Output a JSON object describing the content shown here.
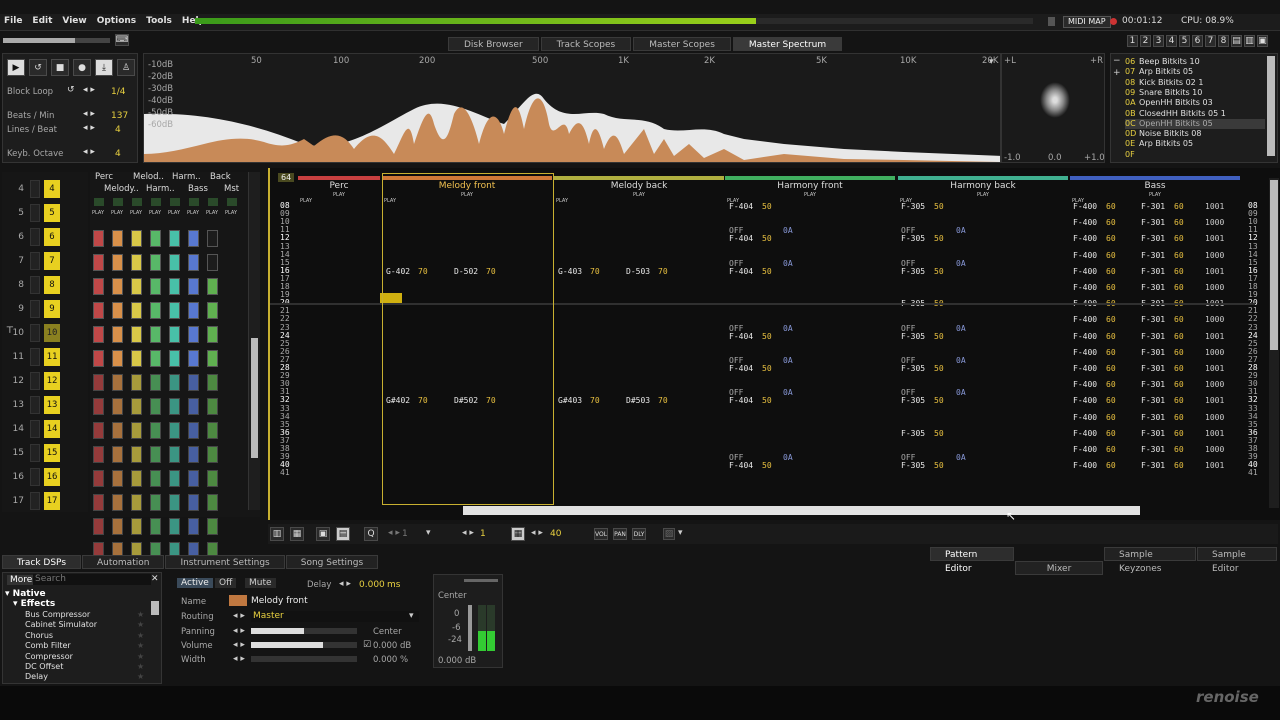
{
  "menu": [
    "File",
    "Edit",
    "View",
    "Options",
    "Tools",
    "Help"
  ],
  "status": {
    "midi_map": "MIDI MAP",
    "time": "00:01:12",
    "cpu": "CPU: 08.9%"
  },
  "screens": [
    "1",
    "2",
    "3",
    "4",
    "5",
    "6",
    "7",
    "8"
  ],
  "scope_tabs": [
    "Disk Browser",
    "Track Scopes",
    "Master Scopes",
    "Master Spectrum"
  ],
  "transport": {
    "block_loop": "Block Loop",
    "block_loop_val": "1/4",
    "bpm_label": "Beats / Min",
    "bpm": "137",
    "lpb_label": "Lines / Beat",
    "lpb": "4",
    "octave_label": "Keyb. Octave",
    "octave": "4"
  },
  "spectrum": {
    "db": [
      "-10dB",
      "-20dB",
      "-30dB",
      "-40dB",
      "-50dB",
      "-60dB"
    ],
    "hz": [
      "50",
      "100",
      "200",
      "500",
      "1K",
      "2K",
      "5K",
      "10K",
      "20K"
    ],
    "l": "+L",
    "r": "+R",
    "axis": [
      "-1.0",
      "0.0",
      "+1.0"
    ]
  },
  "instruments": [
    {
      "id": "06",
      "name": "Beep Bitkits 10"
    },
    {
      "id": "07",
      "name": "Arp Bitkits 05"
    },
    {
      "id": "08",
      "name": "Kick Bitkits 02 1"
    },
    {
      "id": "09",
      "name": "Snare Bitkits 10"
    },
    {
      "id": "0A",
      "name": "OpenHH Bitkits 03"
    },
    {
      "id": "0B",
      "name": "ClosedHH Bitkits 05 1"
    },
    {
      "id": "0C",
      "name": "OpenHH Bitkits 05"
    },
    {
      "id": "0D",
      "name": "Noise Bitkits 08"
    },
    {
      "id": "0E",
      "name": "Arp Bitkits 05"
    },
    {
      "id": "0F",
      "name": ""
    }
  ],
  "sequence": [
    "4",
    "5",
    "6",
    "7",
    "8",
    "9",
    "10",
    "11",
    "12",
    "13",
    "14",
    "15",
    "16",
    "17"
  ],
  "seq_rows": [
    "4",
    "5",
    "6",
    "7",
    "8",
    "9",
    "10",
    "11",
    "12",
    "13",
    "14",
    "15",
    "16",
    "17"
  ],
  "matrix_headers": [
    "Perc",
    "Melod..",
    "Harm..",
    "Back",
    "Melody..",
    "Harm..",
    "Bass",
    "Mst"
  ],
  "play": "PLAY",
  "pattern": {
    "lines": "64",
    "rows": [
      "08",
      "09",
      "10",
      "11",
      "12",
      "13",
      "14",
      "15",
      "16",
      "17",
      "18",
      "19",
      "20",
      "21",
      "22",
      "23",
      "24",
      "25",
      "26",
      "27",
      "28",
      "29",
      "30",
      "31",
      "32",
      "33",
      "34",
      "35",
      "36",
      "37",
      "38",
      "39",
      "40",
      "41"
    ]
  },
  "tracks": [
    {
      "name": "Perc",
      "color": "#c84040"
    },
    {
      "name": "Melody front",
      "color": "#d07838"
    },
    {
      "name": "Melody back",
      "color": "#b0b040"
    },
    {
      "name": "Harmony front",
      "color": "#40b060"
    },
    {
      "name": "Harmony back",
      "color": "#40b090"
    },
    {
      "name": "Bass",
      "color": "#4060c0"
    }
  ],
  "notes": {
    "mel_a": "G-402",
    "mel_a_vol": "70",
    "mel_b": "D-502",
    "mel_b_vol": "70",
    "mel_c": "G#402",
    "mel_d": "D#502",
    "back_a": "G-403",
    "back_b": "D-503",
    "back_c": "G#403",
    "back_d": "D#503",
    "harm": "F-404",
    "harm_vol": "50",
    "harmb": "F-305",
    "off": "OFF",
    "oa": "0A",
    "bass1": "F-400",
    "bass2": "F-301",
    "bass_vol": "60",
    "bfx1": "1001",
    "bfx2": "1000"
  },
  "pattern_toolbar": {
    "step": "1",
    "edit": "1",
    "lines": "40",
    "tags": [
      "VOL",
      "PAN",
      "DLY"
    ]
  },
  "bottom_tabs_left": [
    "Track DSPs",
    "Automation",
    "Instrument Settings",
    "Song Settings"
  ],
  "bottom_tabs_right": [
    "Pattern Editor",
    "Mixer",
    "Sample Keyzones",
    "Sample Editor"
  ],
  "dsp": {
    "more": "More",
    "search": "Search",
    "native": "Native",
    "effects": "Effects",
    "items": [
      "Bus Compressor",
      "Cabinet Simulator",
      "Chorus",
      "Comb Filter",
      "Compressor",
      "DC Offset",
      "Delay"
    ]
  },
  "trackdsp": {
    "active": "Active",
    "off": "Off",
    "mute": "Mute",
    "delay": "Delay",
    "delay_val": "0.000",
    "delay_unit": "ms",
    "name_label": "Name",
    "name": "Melody front",
    "routing_label": "Routing",
    "routing": "Master",
    "panning_label": "Panning",
    "panning": "Center",
    "volume_label": "Volume",
    "volume": "0.000 dB",
    "width_label": "Width",
    "width": "0.000 %"
  },
  "mini_mixer": {
    "pan": "Center",
    "scale": [
      "0",
      "-6",
      "-24"
    ],
    "db": "0.000 dB"
  },
  "logo": "renoise"
}
